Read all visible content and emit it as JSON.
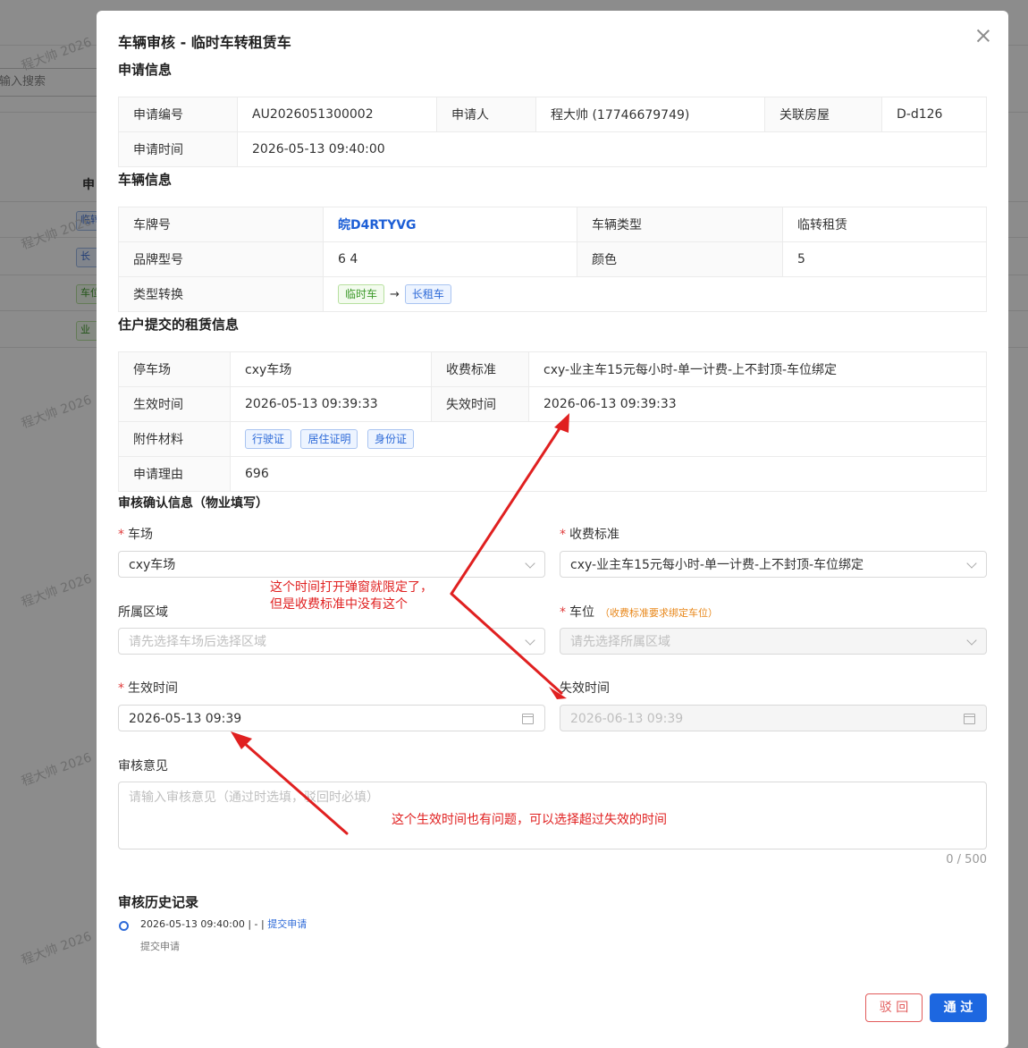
{
  "background": {
    "search_placeholder": "输入搜索",
    "table_header": "申",
    "tags": [
      "临转",
      "长",
      "车位",
      "业"
    ],
    "watermark": "程大帅 2026"
  },
  "modal": {
    "title": "车辆审核 - 临时车转租赁车",
    "close_icon": "close-icon"
  },
  "application": {
    "section_title": "申请信息",
    "rows": [
      {
        "label1": "申请编号",
        "value1": "AU2026051300002",
        "label2": "申请人",
        "value2": "程大帅 (17746679749)",
        "label3": "关联房屋",
        "value3": "D-d126"
      },
      {
        "label1": "申请时间",
        "value1": "2026-05-13 09:40:00"
      }
    ]
  },
  "vehicle": {
    "section_title": "车辆信息",
    "plate_label": "车牌号",
    "plate_value": "皖D4RTYVG",
    "type_label": "车辆类型",
    "type_value": "临转租赁",
    "model_label": "品牌型号",
    "model_value": "6 4",
    "color_label": "颜色",
    "color_value": "5",
    "convert_label": "类型转换",
    "from_tag": "临时车",
    "arrow": "→",
    "to_tag": "长租车"
  },
  "lease": {
    "section_title": "住户提交的租赁信息",
    "lot_label": "停车场",
    "lot_value": "cxy车场",
    "fee_label": "收费标准",
    "fee_value": "cxy-业主车15元每小时-单一计费-上不封顶-车位绑定",
    "start_label": "生效时间",
    "start_value": "2026-05-13 09:39:33",
    "end_label": "失效时间",
    "end_value": "2026-06-13 09:39:33",
    "attach_label": "附件材料",
    "attachments": [
      "行驶证",
      "居住证明",
      "身份证"
    ],
    "reason_label": "申请理由",
    "reason_value": "696"
  },
  "review": {
    "section_title": "审核确认信息（物业填写）",
    "lot_label": "车场",
    "lot_value": "cxy车场",
    "fee_label": "收费标准",
    "fee_value": "cxy-业主车15元每小时-单一计费-上不封顶-车位绑定",
    "area_label": "所属区域",
    "area_placeholder": "请先选择车场后选择区域",
    "space_label": "车位",
    "space_hint": "（收费标准要求绑定车位）",
    "space_placeholder": "请先选择所属区域",
    "start_label": "生效时间",
    "start_value": "2026-05-13 09:39",
    "end_label": "失效时间",
    "end_value": "2026-06-13 09:39",
    "opinion_label": "审核意见",
    "opinion_placeholder": "请输入审核意见（通过时选填，驳回时必填）",
    "counter": "0 / 500"
  },
  "history": {
    "section_title": "审核历史记录",
    "entry_prefix": "2026-05-13 09:40:00 | - | ",
    "entry_action": "提交申请",
    "entry_sub": "提交申请"
  },
  "actions": {
    "reject": "驳 回",
    "pass": "通 过"
  },
  "annotations": {
    "note1_line1": "这个时间打开弹窗就限定了，",
    "note1_line2": "但是收费标准中没有这个",
    "note2": "这个生效时间也有问题，可以选择超过失效的时间",
    "color": "#e02020"
  }
}
